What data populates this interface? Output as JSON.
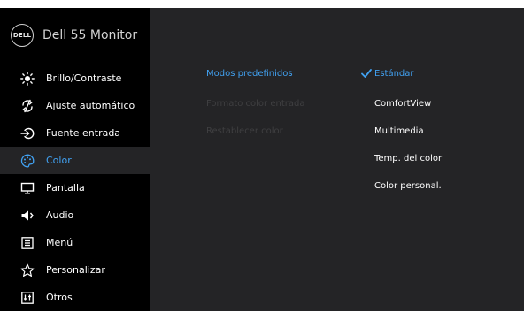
{
  "header": {
    "brand": "DELL",
    "title": "Dell 55 Monitor"
  },
  "sidebar": {
    "items": [
      {
        "label": "Brillo/Contraste",
        "icon": "brightness-icon"
      },
      {
        "label": "Ajuste automático",
        "icon": "auto-adjust-icon"
      },
      {
        "label": "Fuente entrada",
        "icon": "input-source-icon"
      },
      {
        "label": "Color",
        "icon": "palette-icon",
        "active": true
      },
      {
        "label": "Pantalla",
        "icon": "display-icon"
      },
      {
        "label": "Audio",
        "icon": "speaker-icon"
      },
      {
        "label": "Menú",
        "icon": "menu-icon"
      },
      {
        "label": "Personalizar",
        "icon": "star-icon"
      },
      {
        "label": "Otros",
        "icon": "other-icon"
      }
    ]
  },
  "options": [
    {
      "label": "Modos predefinidos",
      "selected": true
    },
    {
      "label": "Formato color entrada",
      "selected": false
    },
    {
      "label": "Restablecer color",
      "selected": false
    }
  ],
  "values": [
    {
      "label": "Estándar",
      "selected": true
    },
    {
      "label": "ComfortView",
      "selected": false
    },
    {
      "label": "Multimedia",
      "selected": false
    },
    {
      "label": "Temp. del color",
      "selected": false
    },
    {
      "label": "Color personal.",
      "selected": false
    }
  ],
  "colors": {
    "accent": "#41a1f1",
    "sidebar_bg": "#000000",
    "panel_bg": "#242426",
    "disabled_text": "#3f3f41"
  }
}
